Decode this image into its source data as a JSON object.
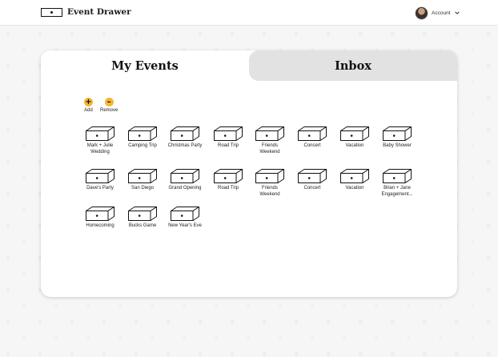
{
  "header": {
    "brand": "Event Drawer",
    "account_label": "Account"
  },
  "tabs": [
    {
      "label": "My Events",
      "active": true
    },
    {
      "label": "Inbox",
      "active": false
    }
  ],
  "actions": {
    "add_label": "Add",
    "remove_label": "Remove",
    "add_symbol": "+",
    "remove_symbol": "–"
  },
  "drawers": [
    {
      "label": "Mark + Julie\nWedding"
    },
    {
      "label": "Camping Trip"
    },
    {
      "label": "Christmas Party"
    },
    {
      "label": "Road Trip"
    },
    {
      "label": "Friends\nWeekend"
    },
    {
      "label": "Concert"
    },
    {
      "label": "Vacation"
    },
    {
      "label": "Baby Shower"
    },
    {
      "label": "Dave's Party"
    },
    {
      "label": "San Diego"
    },
    {
      "label": "Grand Opening"
    },
    {
      "label": "Road Trip"
    },
    {
      "label": "Friends\nWeekend"
    },
    {
      "label": "Concert"
    },
    {
      "label": "Vacation"
    },
    {
      "label": "Brian + Jane\nEngagement..."
    },
    {
      "label": "Homecoming"
    },
    {
      "label": "Bucks Game"
    },
    {
      "label": "New Year's Eve"
    }
  ],
  "colors": {
    "accent": "#f5b731",
    "inactive_tab": "#e2e2e2"
  },
  "icons": {
    "logo": "drawer-logo-icon",
    "drawer": "drawer-icon",
    "chevron": "chevron-down-icon"
  }
}
